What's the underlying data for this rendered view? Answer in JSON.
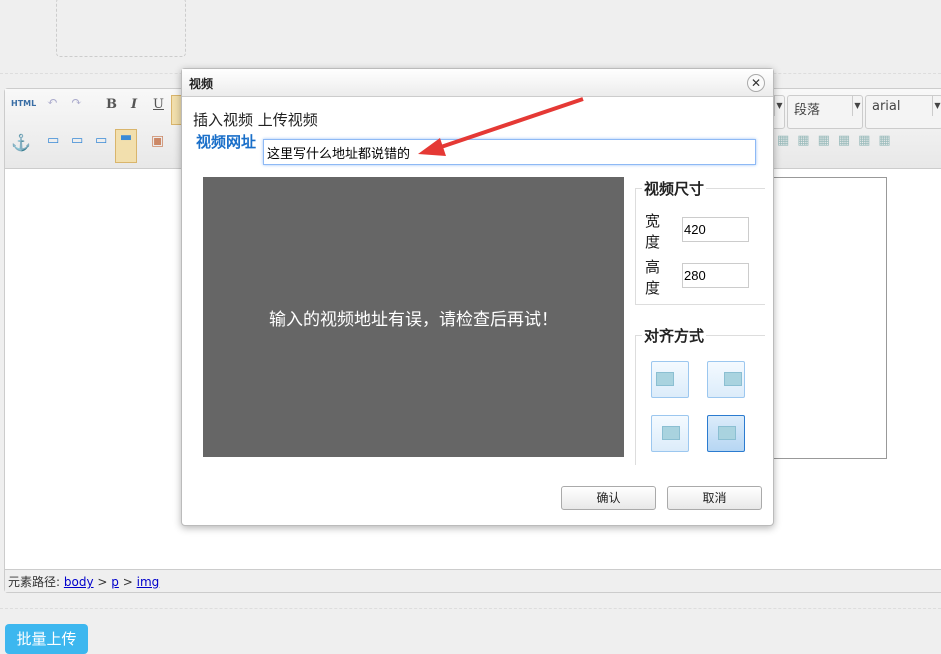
{
  "toolbar": {
    "html_label": "HTML",
    "bold": "B",
    "italic": "I",
    "underline": "U",
    "paragraph_select": "段落",
    "font_select": "arial"
  },
  "path_bar": {
    "label": "元素路径:",
    "items": [
      "body",
      "p",
      "img"
    ],
    "sep": ">"
  },
  "batch_upload": "批量上传",
  "dialog": {
    "title": "视频",
    "tabs": [
      "插入视频",
      "上传视频"
    ],
    "url_label": "视频网址",
    "url_value": "这里写什么地址都说错的",
    "preview_message": "输入的视频地址有误，请检查后再试！",
    "size_legend": "视频尺寸",
    "width_label": "宽度",
    "width_value": "420",
    "height_label": "高度",
    "height_value": "280",
    "align_legend": "对齐方式",
    "align_options": [
      "left",
      "right",
      "center",
      "none"
    ],
    "align_selected": "none",
    "ok": "确认",
    "cancel": "取消"
  },
  "colors": {
    "accent": "#3db7ef",
    "link_label": "#1a6fc9",
    "arrow": "#e53935",
    "preview_bg": "#666666"
  }
}
